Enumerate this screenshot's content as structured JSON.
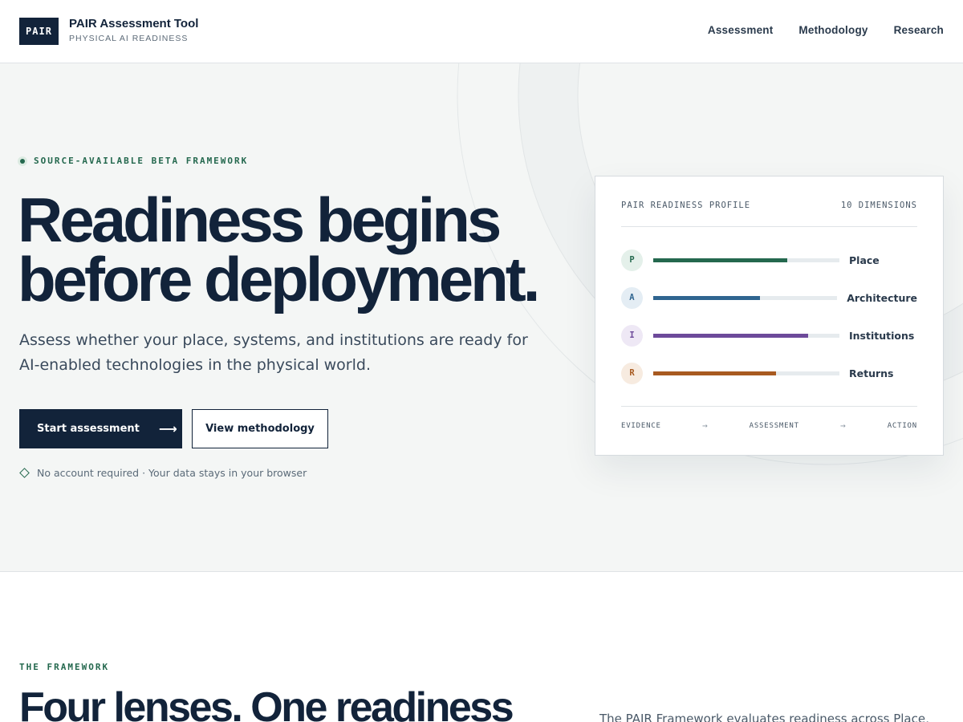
{
  "header": {
    "logo_text": "PAIR",
    "brand_title": "PAIR Assessment Tool",
    "brand_subtitle": "PHYSICAL AI READINESS",
    "nav": [
      {
        "label": "Assessment"
      },
      {
        "label": "Methodology"
      },
      {
        "label": "Research"
      }
    ]
  },
  "hero": {
    "eyebrow": "SOURCE-AVAILABLE BETA FRAMEWORK",
    "title_line1": "Readiness begins",
    "title_line2": "before deployment.",
    "subtitle": "Assess whether your place, systems, and institutions are ready for AI-enabled technologies in the physical world.",
    "primary_button": "Start assessment",
    "primary_arrow": "⟶",
    "secondary_button": "View methodology",
    "note": "No account required · Your data stays in your browser"
  },
  "profile_card": {
    "title": "PAIR READINESS PROFILE",
    "dimensions_count": "10 DIMENSIONS",
    "rows": [
      {
        "letter": "P",
        "label": "Place",
        "level": 0.72,
        "color": "#24684e",
        "badge_bg": "#e4f0ea"
      },
      {
        "letter": "A",
        "label": "Architecture",
        "level": 0.58,
        "color": "#2f6590",
        "badge_bg": "#e4edf4"
      },
      {
        "letter": "I",
        "label": "Institutions",
        "level": 0.83,
        "color": "#6d4a9a",
        "badge_bg": "#eee8f5"
      },
      {
        "letter": "R",
        "label": "Returns",
        "level": 0.66,
        "color": "#a85a20",
        "badge_bg": "#f7ebe0"
      }
    ],
    "flow": [
      "EVIDENCE",
      "ASSESSMENT",
      "ACTION"
    ],
    "flow_arrow": "→"
  },
  "framework": {
    "eyebrow": "THE FRAMEWORK",
    "title": "Four lenses. One readiness",
    "text": "The PAIR Framework evaluates readiness across Place,"
  }
}
